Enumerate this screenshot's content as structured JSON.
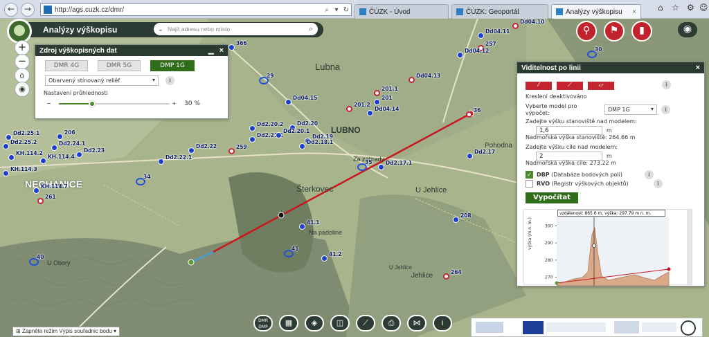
{
  "browser": {
    "url": "http://ags.cuzk.cz/dmr/",
    "tabs": [
      "ČÚZK - Úvod",
      "ČÚZK: Geoportál",
      "Analýzy výškopisu"
    ]
  },
  "app": {
    "title": "Analýzy výškopisu",
    "search_placeholder": "Najít adresu nebo místo"
  },
  "source_panel": {
    "title": "Zdroj výškopisných dat",
    "buttons": [
      "DMR 4G",
      "DMR 5G",
      "DMP 1G"
    ],
    "active_button": "DMP 1G",
    "relief_select": "Obarvený stínovaný reliéf",
    "transparency_label": "Nastavení průhlednosti",
    "transparency_value": "30 %",
    "transparency_fraction": 0.3
  },
  "visibility_panel": {
    "title": "Viditelnost po linii",
    "status": "Kreslení deaktivováno",
    "model_label": "Vyberte model pro výpočet:",
    "model_value": "DMP 1G",
    "observer_label": "Zadejte výšku stanoviště nad modelem:",
    "observer_value": "1,6",
    "unit_m": "m",
    "observer_altitude": "Nadmořská výška stanoviště: 264.66 m",
    "target_label": "Zadejte výšku cíle nad modelem:",
    "target_value": "2",
    "target_altitude": "Nadmořská výška cíle: 273.22 m",
    "dbp_label": "DBP",
    "dbp_desc": "(Databáze bodových polí)",
    "dbp_checked": true,
    "rvo_label": "RVO",
    "rvo_desc": "(Registr výškových objektů)",
    "rvo_checked": false,
    "compute_button": "Vypočítat",
    "profile_tooltip": "vzdálenost: 865.6 m, výška: 297.79 m n. m.",
    "chart": {
      "ylabel": "výška (m n. m.)",
      "yticks": [
        270,
        280,
        290,
        300
      ]
    }
  },
  "map_labels": {
    "lubna": "Lubna",
    "lubno": "LUBNO",
    "nechanice": "NECHANICE",
    "sterkovec": "Šterkovec",
    "u_jehlice": "U Jehlice",
    "jehlice": "Jehlice",
    "na_padoline": "Na padoline",
    "u_obory": "U Obory",
    "pohodna": "Pohodna",
    "za_zahrady": "Za zahrady",
    "u_jehlice2": "U Jehlice"
  },
  "points": [
    "Dd04.10",
    "Dd04.11",
    "257",
    "Dd04.12",
    "30",
    "366",
    "29",
    "Dd04.13",
    "Dd04.15",
    "201.1",
    "201.2",
    "201",
    "Dd04.14",
    "36",
    "Dd2.20.2",
    "Dd2.20",
    "Dd2.21.1",
    "Dd2.20.1",
    "Dd2.19",
    "Dd2.18.1",
    "Dd2.17",
    "Dd2.25.1",
    "206",
    "Dd2.25.2",
    "Dd2.24.1",
    "Dd2.23",
    "KH.114.2",
    "KH.114.4",
    "Dd2.22",
    "259",
    "Dd2.22.1",
    "35",
    "Dd2.17.1",
    "KH.114.3",
    "34",
    "KH.114.7",
    "261",
    "41.1",
    "208",
    "41",
    "41.2",
    "40",
    "264"
  ],
  "statusbar": {
    "text": "Zapněte režim Výpis souřadnic bodu"
  },
  "bottom_toolbar": [
    "DMR DMP"
  ]
}
